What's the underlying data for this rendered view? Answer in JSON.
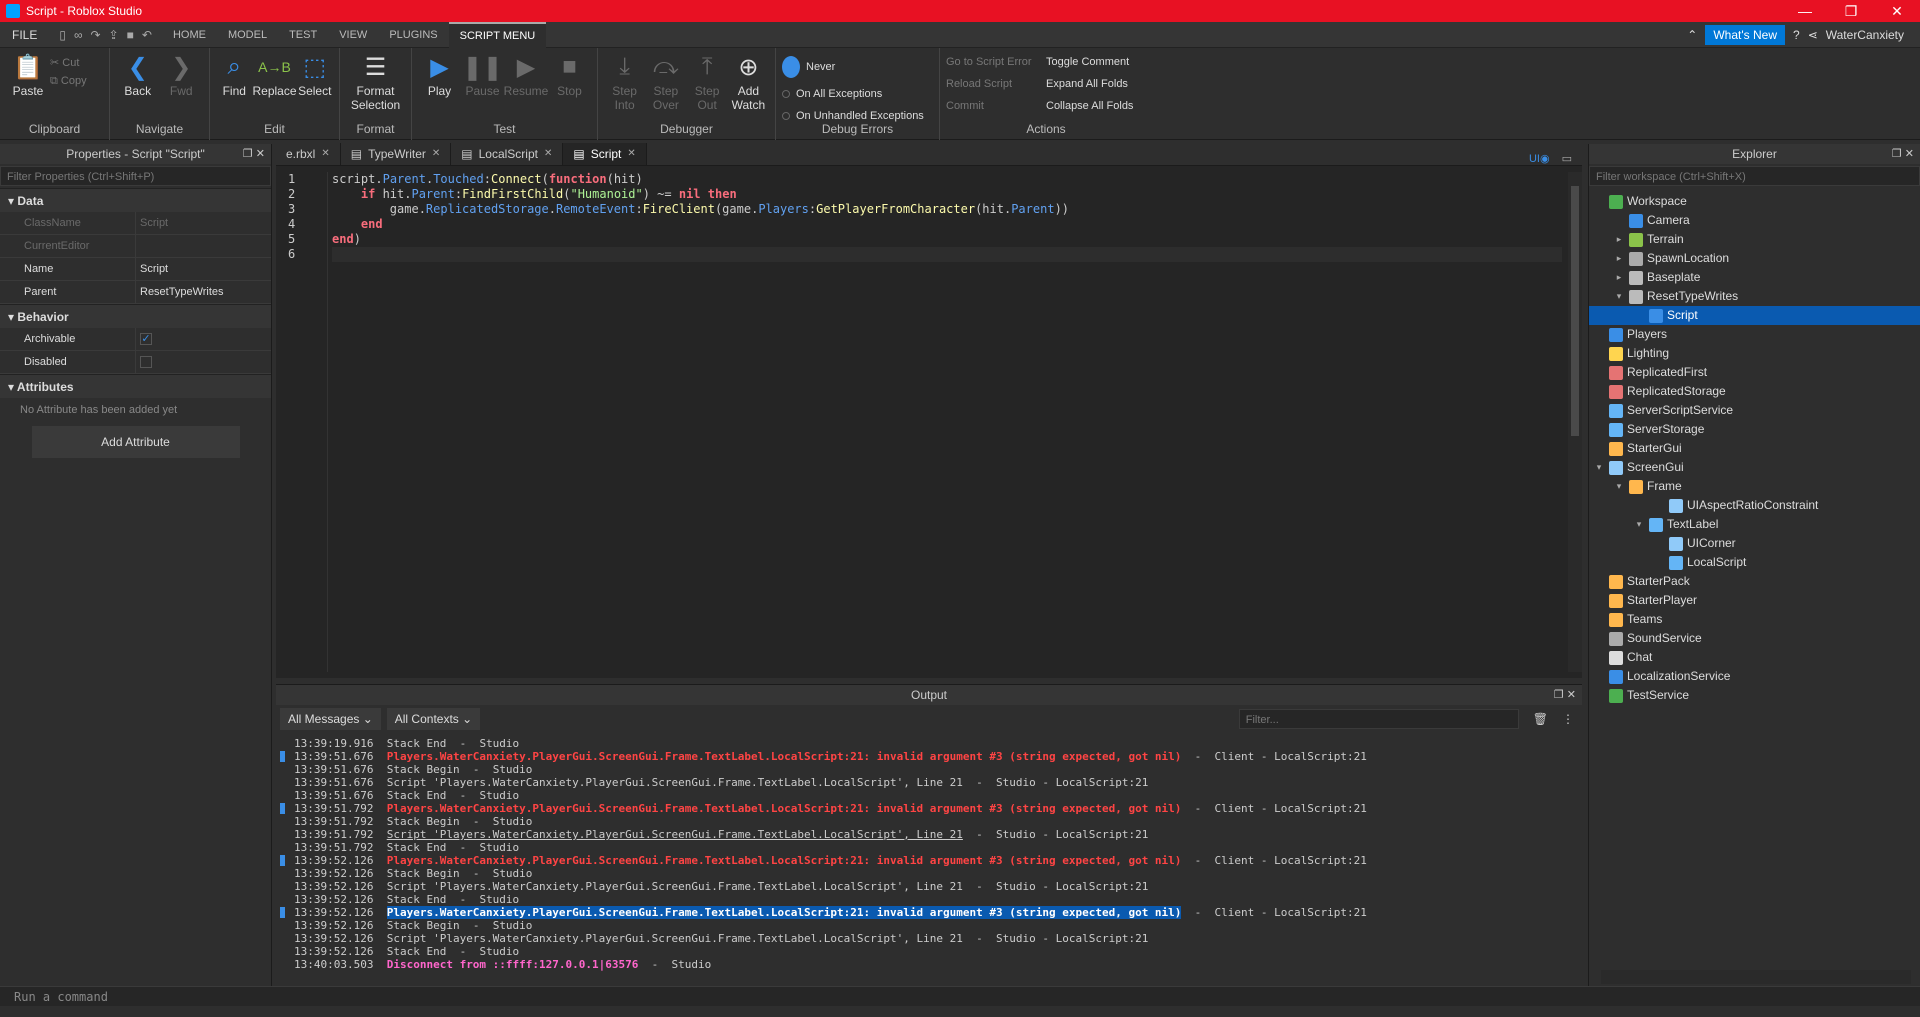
{
  "window": {
    "title": "Script - Roblox Studio"
  },
  "menubar": {
    "file": "FILE",
    "tabs": [
      "HOME",
      "MODEL",
      "TEST",
      "VIEW",
      "PLUGINS",
      "SCRIPT MENU"
    ],
    "whats_new": "What's New",
    "user": "WaterCanxiety"
  },
  "ribbon": {
    "clipboard": {
      "label": "Clipboard",
      "paste": "Paste",
      "cut": "Cut",
      "copy": "Copy"
    },
    "navigate": {
      "label": "Navigate",
      "back": "Back",
      "fwd": "Fwd"
    },
    "edit": {
      "label": "Edit",
      "find": "Find",
      "replace": "Replace",
      "select": "Select"
    },
    "format": {
      "label": "Format",
      "format_selection": "Format Selection"
    },
    "test": {
      "label": "Test",
      "play": "Play",
      "pause": "Pause",
      "resume": "Resume",
      "stop": "Stop"
    },
    "debugger": {
      "label": "Debugger",
      "step_into": "Step Into",
      "step_over": "Step Over",
      "step_out": "Step Out",
      "add_watch": "Add Watch"
    },
    "debug_errors": {
      "label": "Debug Errors",
      "never": "Never",
      "all": "On All Exceptions",
      "unhandled": "On Unhandled Exceptions"
    },
    "actions": {
      "label": "Actions",
      "go_to_error": "Go to Script Error",
      "reload": "Reload Script",
      "commit": "Commit",
      "toggle_comment": "Toggle Comment",
      "expand": "Expand All Folds",
      "collapse": "Collapse All Folds"
    }
  },
  "properties": {
    "title": "Properties - Script \"Script\"",
    "filter": "Filter Properties (Ctrl+Shift+P)",
    "sections": {
      "data": "Data",
      "behavior": "Behavior",
      "attributes": "Attributes"
    },
    "rows": {
      "classname": {
        "k": "ClassName",
        "v": "Script"
      },
      "currenteditor": {
        "k": "CurrentEditor",
        "v": ""
      },
      "name": {
        "k": "Name",
        "v": "Script"
      },
      "parent": {
        "k": "Parent",
        "v": "ResetTypeWrites"
      },
      "archivable": {
        "k": "Archivable"
      },
      "disabled": {
        "k": "Disabled"
      }
    },
    "no_attr": "No Attribute has been added yet",
    "add_attr": "Add Attribute"
  },
  "editor": {
    "tabs": [
      "e.rbxl",
      "TypeWriter",
      "LocalScript",
      "Script"
    ],
    "line_numbers": [
      "1",
      "2",
      "3",
      "4",
      "5",
      "6"
    ]
  },
  "output": {
    "title": "Output",
    "all_messages": "All Messages",
    "all_contexts": "All Contexts",
    "filter": "Filter...",
    "logs": [
      {
        "ts": "13:39:19.916",
        "msg": "Stack End",
        "tail": "  -  Studio"
      },
      {
        "ts": "13:39:51.676",
        "msg": "Players.WaterCanxiety.PlayerGui.ScreenGui.Frame.TextLabel.LocalScript:21: invalid argument #3 (string expected, got nil)",
        "tail": "  -  Client - LocalScript:21"
      },
      {
        "ts": "13:39:51.676",
        "msg": "Stack Begin",
        "tail": "  -  Studio"
      },
      {
        "ts": "13:39:51.676",
        "msg": "Script 'Players.WaterCanxiety.PlayerGui.ScreenGui.Frame.TextLabel.LocalScript', Line 21",
        "tail": "  -  Studio - LocalScript:21"
      },
      {
        "ts": "13:39:51.676",
        "msg": "Stack End",
        "tail": "  -  Studio"
      },
      {
        "ts": "13:39:51.792",
        "msg": "Players.WaterCanxiety.PlayerGui.ScreenGui.Frame.TextLabel.LocalScript:21: invalid argument #3 (string expected, got nil)",
        "tail": "  -  Client - LocalScript:21"
      },
      {
        "ts": "13:39:51.792",
        "msg": "Stack Begin",
        "tail": "  -  Studio"
      },
      {
        "ts": "13:39:51.792",
        "msg": "Script 'Players.WaterCanxiety.PlayerGui.ScreenGui.Frame.TextLabel.LocalScript', Line 21",
        "tail": "  -  Studio - LocalScript:21"
      },
      {
        "ts": "13:39:51.792",
        "msg": "Stack End",
        "tail": "  -  Studio"
      },
      {
        "ts": "13:39:52.126",
        "msg": "Players.WaterCanxiety.PlayerGui.ScreenGui.Frame.TextLabel.LocalScript:21: invalid argument #3 (string expected, got nil)",
        "tail": "  -  Client - LocalScript:21"
      },
      {
        "ts": "13:39:52.126",
        "msg": "Stack Begin",
        "tail": "  -  Studio"
      },
      {
        "ts": "13:39:52.126",
        "msg": "Script 'Players.WaterCanxiety.PlayerGui.ScreenGui.Frame.TextLabel.LocalScript', Line 21",
        "tail": "  -  Studio - LocalScript:21"
      },
      {
        "ts": "13:39:52.126",
        "msg": "Stack End",
        "tail": "  -  Studio"
      },
      {
        "ts": "13:39:52.126",
        "msg": "Players.WaterCanxiety.PlayerGui.ScreenGui.Frame.TextLabel.LocalScript:21: invalid argument #3 (string expected, got nil)",
        "tail": "  -  Client - LocalScript:21"
      },
      {
        "ts": "13:39:52.126",
        "msg": "Stack Begin",
        "tail": "  -  Studio"
      },
      {
        "ts": "13:39:52.126",
        "msg": "Script 'Players.WaterCanxiety.PlayerGui.ScreenGui.Frame.TextLabel.LocalScript', Line 21",
        "tail": "  -  Studio - LocalScript:21"
      },
      {
        "ts": "13:39:52.126",
        "msg": "Stack End",
        "tail": "  -  Studio"
      },
      {
        "ts": "13:40:03.503",
        "msg": "Disconnect from ::ffff:127.0.0.1|63576",
        "tail": "  -  Studio"
      }
    ]
  },
  "command": {
    "placeholder": "Run a command"
  },
  "explorer": {
    "title": "Explorer",
    "filter": "Filter workspace (Ctrl+Shift+X)",
    "items": [
      "Workspace",
      "Camera",
      "Terrain",
      "SpawnLocation",
      "Baseplate",
      "ResetTypeWrites",
      "Script",
      "Players",
      "Lighting",
      "ReplicatedFirst",
      "ReplicatedStorage",
      "ServerScriptService",
      "ServerStorage",
      "StarterGui",
      "ScreenGui",
      "Frame",
      "UIAspectRatioConstraint",
      "TextLabel",
      "UICorner",
      "LocalScript",
      "StarterPack",
      "StarterPlayer",
      "Teams",
      "SoundService",
      "Chat",
      "LocalizationService",
      "TestService"
    ]
  }
}
